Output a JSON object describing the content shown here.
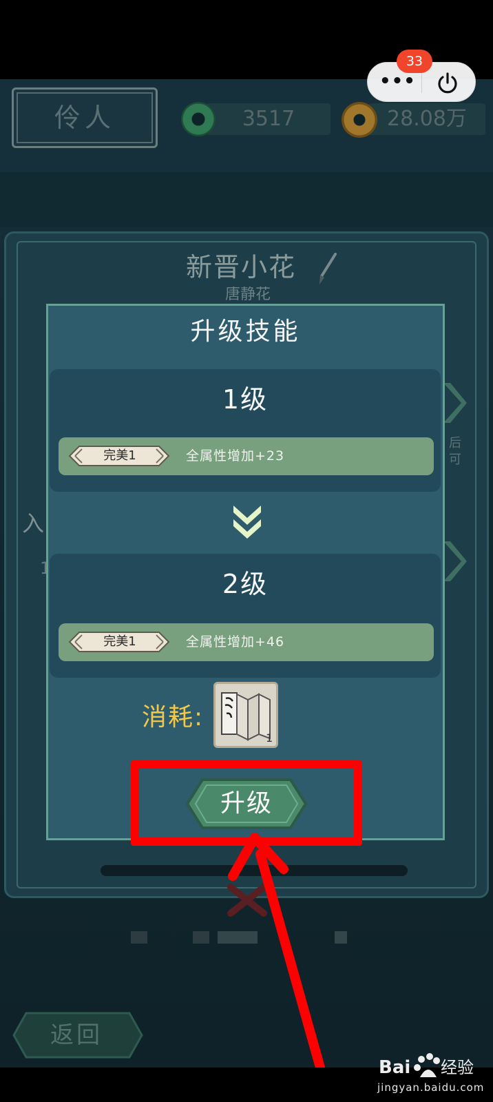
{
  "header": {
    "name": "伶人",
    "jade_amount": "3517",
    "gold_amount": "28.08万"
  },
  "capsule": {
    "badge_count": "33"
  },
  "card": {
    "title": "新晋小花",
    "subtitle": "唐静花",
    "side_text": "后\n可"
  },
  "dialog": {
    "title": "升级技能",
    "current": {
      "level": "1级",
      "tag": "完美1",
      "attribute": "全属性增加+23"
    },
    "next": {
      "level": "2级",
      "tag": "完美1",
      "attribute": "全属性增加+46"
    },
    "cost_label": "消耗:",
    "cost_item": {
      "icon": "skill-book-scroll",
      "quantity": "1"
    },
    "upgrade_label": "升级"
  },
  "footer": {
    "back_label": "返回"
  },
  "watermark": {
    "logo_text": "Bai 经验",
    "url": "jingyan.baidu.com"
  },
  "colors": {
    "dialog_bg": "#2e5c6d",
    "attr_bar": "#79a07e",
    "cost_label": "#f2c84a",
    "annotation": "#ff0000"
  }
}
